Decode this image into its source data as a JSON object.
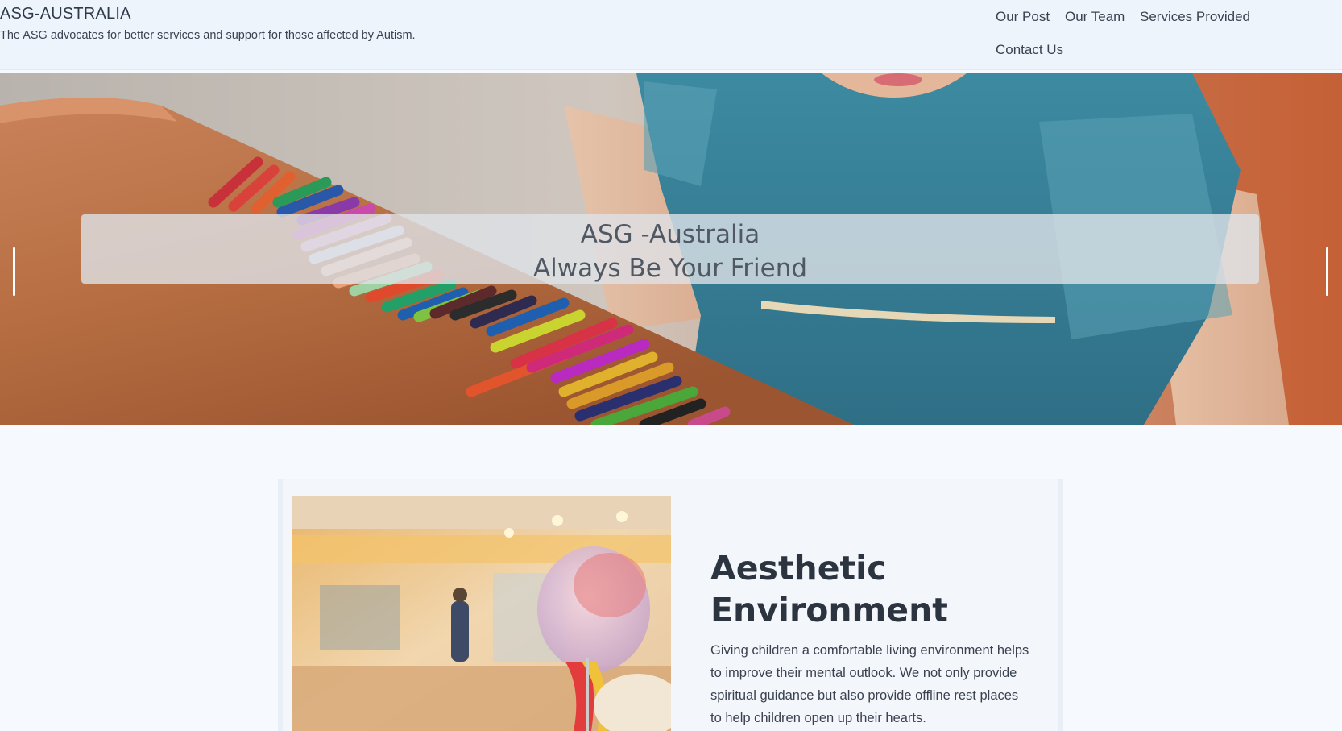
{
  "brand": {
    "title": "ASG-AUSTRALIA",
    "tagline": "The ASG advocates for better services and support for those affected by Autism."
  },
  "nav": {
    "items": [
      {
        "label": "Our Post"
      },
      {
        "label": "Our Team"
      },
      {
        "label": "Services Provided"
      },
      {
        "label": "Contact Us"
      }
    ]
  },
  "hero": {
    "caption_line1": "ASG -Australia",
    "caption_line2": "Always Be Your Friend",
    "image_icon": "crayons-photo",
    "prev_icon": "carousel-prev-icon",
    "next_icon": "carousel-next-icon"
  },
  "feature": {
    "title": "Aesthetic Environment",
    "text": "Giving children a comfortable living environment helps to improve their mental outlook. We not only provide spiritual guidance but also provide offline rest places to help children open up their hearts.",
    "image_icon": "skull-model-photo"
  },
  "colors": {
    "header_bg": "#eef4fb",
    "page_bg": "#f6f9fd",
    "caption_bg": "#dee2e7",
    "dress_blue": "#3f8aa0",
    "table_wood": "#b96a3c"
  }
}
